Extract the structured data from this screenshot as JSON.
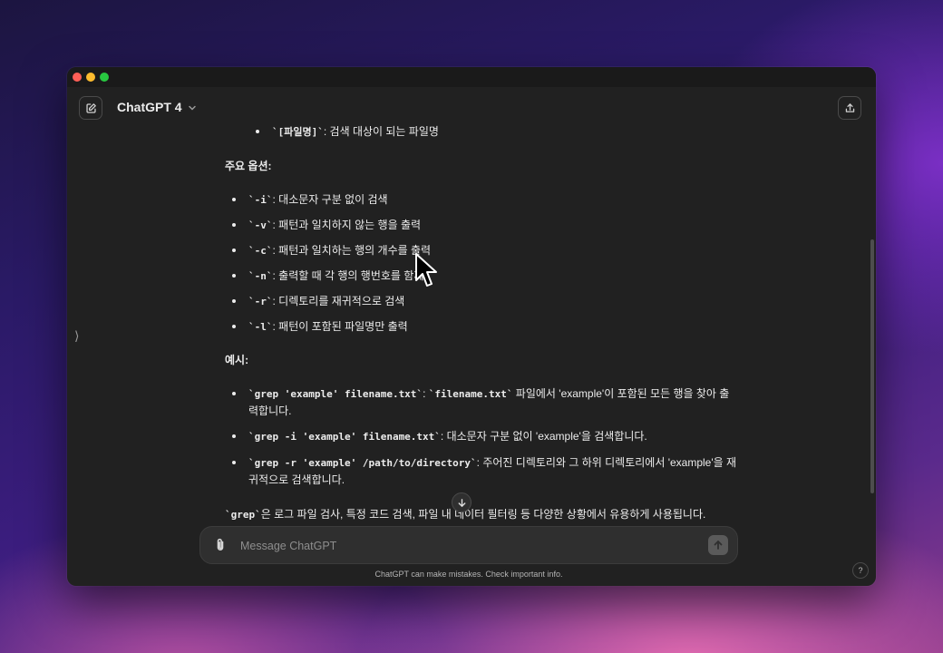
{
  "header": {
    "model_name": "ChatGPT 4",
    "new_chat_icon": "pencil-square-icon",
    "share_icon": "share-icon",
    "dropdown_icon": "chevron-down-icon"
  },
  "sidebar": {
    "toggle_label": "⟩"
  },
  "message": {
    "top_item": {
      "code": "`[파일명]`",
      "text": ": 검색 대상이 되는 파일명"
    },
    "options_heading": "주요 옵션:",
    "options": [
      {
        "code": "`-i`",
        "text": ": 대소문자 구분 없이 검색"
      },
      {
        "code": "`-v`",
        "text": ": 패턴과 일치하지 않는 행을 출력"
      },
      {
        "code": "`-c`",
        "text": ": 패턴과 일치하는 행의 개수를 출력"
      },
      {
        "code": "`-n`",
        "text": ": 출력할 때 각 행의 행번호를 함께"
      },
      {
        "code": "`-r`",
        "text": ": 디렉토리를 재귀적으로 검색"
      },
      {
        "code": "`-l`",
        "text": ": 패턴이 포함된 파일명만 출력"
      }
    ],
    "examples_heading": "예시:",
    "examples": [
      {
        "code": "`grep 'example' filename.txt`",
        "sep": ": ",
        "code2": "`filename.txt`",
        "text": " 파일에서 'example'이 포함된 모든 행을 찾아 출력합니다."
      },
      {
        "code": "`grep -i 'example' filename.txt`",
        "text": ": 대소문자 구분 없이 'example'을 검색합니다."
      },
      {
        "code": "`grep -r 'example' /path/to/directory`",
        "text": ": 주어진 디렉토리와 그 하위 디렉토리에서 'example'을 재귀적으로 검색합니다."
      }
    ],
    "summary": {
      "code": "`grep`",
      "text": "은 로그 파일 검사, 특정 코드 검색, 파일 내 데이터 필터링 등 다양한 상황에서 유용하게 사용됩니다."
    }
  },
  "composer": {
    "placeholder": "Message ChatGPT",
    "attach_icon": "paperclip-icon",
    "send_icon": "arrow-up-icon"
  },
  "footer": {
    "disclaimer": "ChatGPT can make mistakes. Check important info.",
    "help_label": "?"
  },
  "colors": {
    "window_bg": "#212121",
    "composer_bg": "#2f2f2f",
    "text": "#ececec"
  }
}
